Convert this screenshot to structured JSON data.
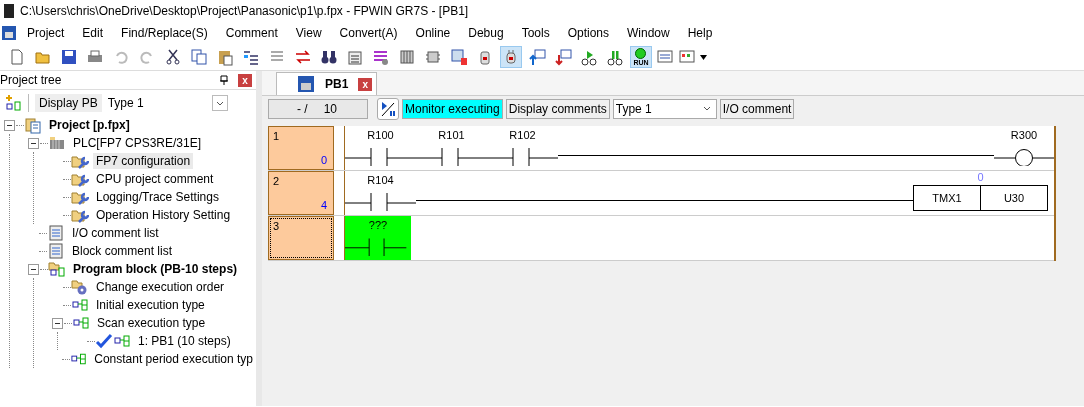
{
  "window": {
    "title": "C:\\Users\\chris\\OneDrive\\Desktop\\Project\\Panasonic\\p1\\p.fpx - FPWIN GR7S - [PB1]"
  },
  "menu": [
    "Project",
    "Edit",
    "Find/Replace(S)",
    "Comment",
    "View",
    "Convert(A)",
    "Online",
    "Debug",
    "Tools",
    "Options",
    "Window",
    "Help"
  ],
  "toolbar": {
    "monitor_pressed": true,
    "run_pressed": true,
    "run_label": "RUN"
  },
  "project_tree": {
    "title": "Project tree",
    "close": "x",
    "display_button": "Display PB",
    "type_select": "Type 1",
    "items": [
      {
        "label": "Project [p.fpx]",
        "kind": "project",
        "bold": true,
        "selected": false,
        "expanded": true,
        "children": [
          {
            "label": "PLC[FP7 CPS3RE/31E]",
            "kind": "plc",
            "bold": false,
            "selected": false,
            "expanded": true,
            "children": [
              {
                "label": "FP7 configuration",
                "kind": "setting",
                "bold": false,
                "selected": true
              },
              {
                "label": "CPU project comment",
                "kind": "setting",
                "bold": false,
                "selected": false
              },
              {
                "label": "Logging/Trace Settings",
                "kind": "setting",
                "bold": false,
                "selected": false
              },
              {
                "label": "Operation History Setting",
                "kind": "setting",
                "bold": false,
                "selected": false
              }
            ]
          },
          {
            "label": "I/O comment list",
            "kind": "list",
            "bold": false,
            "selected": false
          },
          {
            "label": "Block comment list",
            "kind": "list",
            "bold": false,
            "selected": false
          },
          {
            "label": "Program block (PB-10 steps)",
            "kind": "block-folder",
            "bold": true,
            "selected": false,
            "expanded": true,
            "children": [
              {
                "label": "Change execution order",
                "kind": "gear",
                "bold": false,
                "selected": false
              },
              {
                "label": "Initial execution type",
                "kind": "block",
                "bold": false,
                "selected": false
              },
              {
                "label": "Scan execution type",
                "kind": "block",
                "bold": false,
                "selected": false,
                "expanded": true,
                "children": [
                  {
                    "label": "1: PB1 (10 steps)",
                    "kind": "block",
                    "bold": false,
                    "selected": false,
                    "active": true
                  }
                ]
              },
              {
                "label": "Constant period execution typ",
                "kind": "block",
                "bold": false,
                "selected": false
              }
            ]
          }
        ]
      }
    ]
  },
  "tabs": [
    {
      "label": "PB1",
      "selected": true,
      "close": "x"
    }
  ],
  "ladder_toolbar": {
    "step": "- /",
    "step_total": "10",
    "monitor": "Monitor executing",
    "monitor_on": true,
    "display_comments": "Display comments",
    "comment_type": "Type 1",
    "io_comment": "I/O comment"
  },
  "rungs": [
    {
      "number": "1",
      "address": "0",
      "selected": false,
      "elements": [
        {
          "kind": "contact",
          "label": "R100"
        },
        {
          "kind": "contact",
          "label": "R101"
        },
        {
          "kind": "contact",
          "label": "R102"
        }
      ],
      "output": {
        "kind": "coil",
        "label": "R300"
      }
    },
    {
      "number": "2",
      "address": "4",
      "selected": false,
      "elements": [
        {
          "kind": "contact",
          "label": "R104"
        }
      ],
      "output": {
        "kind": "timer",
        "instruction": "TMX1",
        "setting": "U30",
        "value": "0"
      }
    },
    {
      "number": "3",
      "selected": true,
      "elements": [
        {
          "kind": "cursor",
          "label": "???"
        }
      ]
    }
  ]
}
